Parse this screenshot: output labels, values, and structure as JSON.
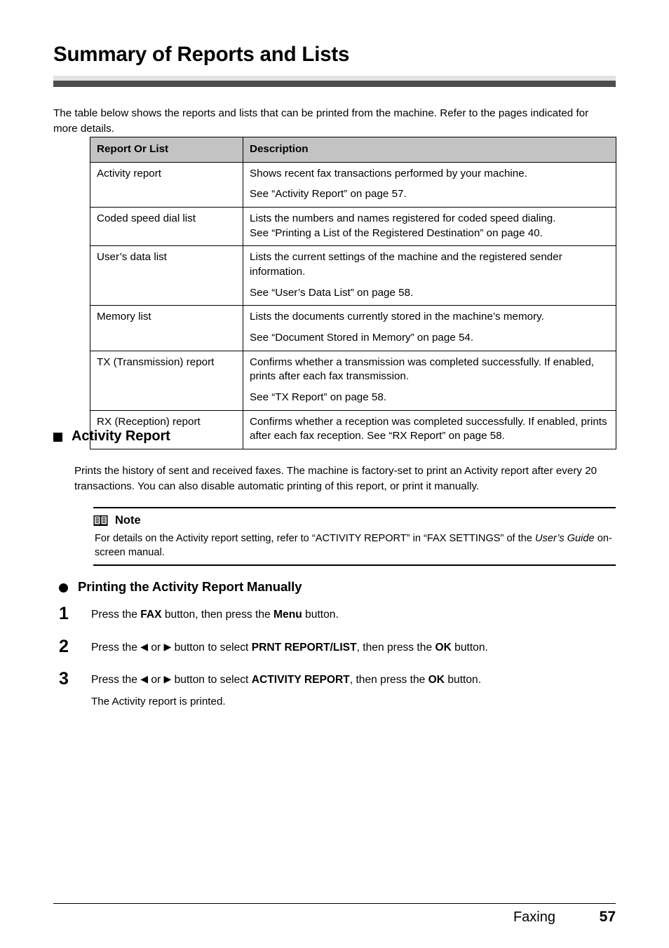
{
  "page": {
    "title": "Summary of Reports and Lists",
    "intro": "The table below shows the reports and lists that can be printed from the machine. Refer to the pages indicated for more details."
  },
  "table": {
    "headers": [
      "Report Or List",
      "Description"
    ],
    "rows": [
      {
        "name": "Activity report",
        "desc_lines": [
          "Shows recent fax transactions performed by your machine.",
          "See “Activity Report” on page 57."
        ],
        "spaced": true
      },
      {
        "name": "Coded speed dial list",
        "desc_lines": [
          "Lists the numbers and names registered for coded speed dialing.",
          "See “Printing a List of the Registered Destination” on page 40."
        ],
        "spaced": false
      },
      {
        "name": "User’s data list",
        "desc_lines": [
          "Lists the current settings of the machine and the registered sender information.",
          "See “User’s Data List” on page 58."
        ],
        "spaced": true
      },
      {
        "name": "Memory list",
        "desc_lines": [
          "Lists the documents currently stored in the machine’s memory.",
          "See “Document Stored in Memory” on page 54."
        ],
        "spaced": true
      },
      {
        "name": "TX (Transmission) report",
        "desc_lines": [
          "Confirms whether a transmission was completed successfully. If enabled, prints after each fax transmission.",
          "See “TX Report” on page 58."
        ],
        "spaced": true
      },
      {
        "name": "RX (Reception) report",
        "desc_lines": [
          "Confirms whether a reception was completed successfully. If enabled, prints after each fax reception. See “RX Report” on page 58."
        ],
        "spaced": false
      }
    ]
  },
  "activity_section": {
    "heading": "Activity Report",
    "body": "Prints the history of sent and received faxes. The machine is factory-set to print an Activity report after every 20 transactions. You can also disable automatic printing of this report, or print it manually."
  },
  "note": {
    "icon": "open-book-icon",
    "title": "Note",
    "text_before_italic": "For details on the Activity report setting, refer to “ACTIVITY REPORT” in “FAX SETTINGS” of the ",
    "italic_text": "User’s Guide",
    "text_after_italic": " on-screen manual."
  },
  "procedure": {
    "heading": "Printing the Activity Report Manually",
    "steps": [
      {
        "number": "1",
        "parts": [
          {
            "t": "Press the ",
            "b": false
          },
          {
            "t": "FAX",
            "b": true
          },
          {
            "t": " button, then press the ",
            "b": false
          },
          {
            "t": "Menu",
            "b": true
          },
          {
            "t": " button.",
            "b": false
          }
        ],
        "sub": ""
      },
      {
        "number": "2",
        "parts": [
          {
            "t": "Press the ",
            "b": false
          },
          {
            "t": "◀",
            "b": false,
            "arrow": true
          },
          {
            "t": " or ",
            "b": false
          },
          {
            "t": "▶",
            "b": false,
            "arrow": true
          },
          {
            "t": " button to select ",
            "b": false
          },
          {
            "t": "PRNT REPORT/LIST",
            "b": true
          },
          {
            "t": ", then press the ",
            "b": false
          },
          {
            "t": "OK",
            "b": true
          },
          {
            "t": " button.",
            "b": false
          }
        ],
        "sub": ""
      },
      {
        "number": "3",
        "parts": [
          {
            "t": "Press the ",
            "b": false
          },
          {
            "t": "◀",
            "b": false,
            "arrow": true
          },
          {
            "t": " or ",
            "b": false
          },
          {
            "t": "▶",
            "b": false,
            "arrow": true
          },
          {
            "t": " button to select ",
            "b": false
          },
          {
            "t": "ACTIVITY REPORT",
            "b": true
          },
          {
            "t": ", then press the ",
            "b": false
          },
          {
            "t": "OK",
            "b": true
          },
          {
            "t": " button.",
            "b": false
          }
        ],
        "sub": "The Activity report is printed."
      }
    ]
  },
  "footer": {
    "section": "Faxing",
    "page_number": "57"
  },
  "colors": {
    "rule_light": "#e3e3e3",
    "rule_dark": "#4d4d4d",
    "table_header_bg": "#c3c3c3",
    "text": "#000000"
  }
}
